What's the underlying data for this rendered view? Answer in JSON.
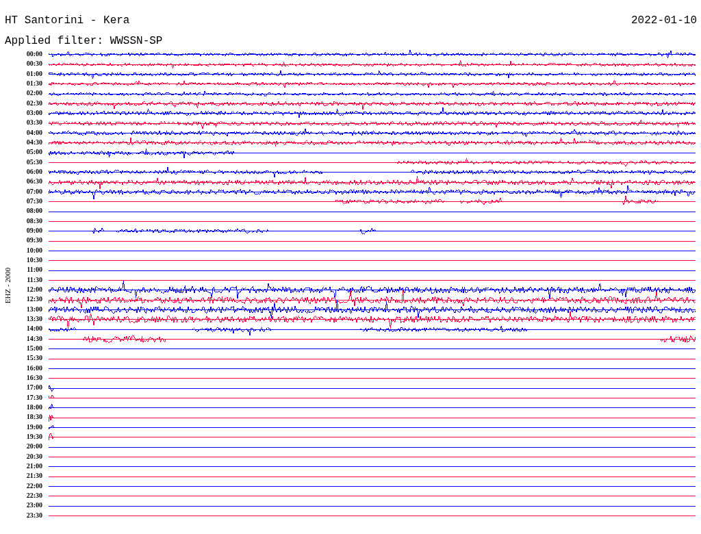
{
  "header": {
    "title": "HT Santorini - Kera",
    "filter": "Applied filter: WWSSN-SP",
    "date": "2022-01-10"
  },
  "channel_label": "EHZ - 2000",
  "traces": [
    {
      "time": "00:00",
      "color": "#0000ff"
    },
    {
      "time": "00:30",
      "color": "#ff0040"
    },
    {
      "time": "01:00",
      "color": "#0000ff"
    },
    {
      "time": "01:30",
      "color": "#ff0040"
    },
    {
      "time": "02:00",
      "color": "#0000ff"
    },
    {
      "time": "02:30",
      "color": "#ff0040"
    },
    {
      "time": "03:00",
      "color": "#0000ff"
    },
    {
      "time": "03:30",
      "color": "#ff0040"
    },
    {
      "time": "04:00",
      "color": "#0000ff"
    },
    {
      "time": "04:30",
      "color": "#ff0040"
    },
    {
      "time": "05:00",
      "color": "#0000ff"
    },
    {
      "time": "05:30",
      "color": "#ff0040"
    },
    {
      "time": "06:00",
      "color": "#0000ff"
    },
    {
      "time": "06:30",
      "color": "#ff0040"
    },
    {
      "time": "07:00",
      "color": "#0000ff"
    },
    {
      "time": "07:30",
      "color": "#ff0040"
    },
    {
      "time": "08:00",
      "color": "#0000ff"
    },
    {
      "time": "08:30",
      "color": "#ff0040"
    },
    {
      "time": "09:00",
      "color": "#0000ff"
    },
    {
      "time": "09:30",
      "color": "#ff0040"
    },
    {
      "time": "10:00",
      "color": "#0000ff"
    },
    {
      "time": "10:30",
      "color": "#ff0040"
    },
    {
      "time": "11:00",
      "color": "#0000ff"
    },
    {
      "time": "11:30",
      "color": "#ff0040"
    },
    {
      "time": "12:00",
      "color": "#0000ff"
    },
    {
      "time": "12:30",
      "color": "#ff0040"
    },
    {
      "time": "13:00",
      "color": "#0000ff"
    },
    {
      "time": "13:30",
      "color": "#ff0040"
    },
    {
      "time": "14:00",
      "color": "#0000ff"
    },
    {
      "time": "14:30",
      "color": "#ff0040"
    },
    {
      "time": "15:00",
      "color": "#0000ff"
    },
    {
      "time": "15:30",
      "color": "#ff0040"
    },
    {
      "time": "16:00",
      "color": "#0000ff"
    },
    {
      "time": "16:30",
      "color": "#ff0040"
    },
    {
      "time": "17:00",
      "color": "#0000ff"
    },
    {
      "time": "17:30",
      "color": "#ff0040"
    },
    {
      "time": "18:00",
      "color": "#0000ff"
    },
    {
      "time": "18:30",
      "color": "#ff0040"
    },
    {
      "time": "19:00",
      "color": "#0000ff"
    },
    {
      "time": "19:30",
      "color": "#ff0040"
    },
    {
      "time": "20:00",
      "color": "#0000ff"
    },
    {
      "time": "20:30",
      "color": "#ff0040"
    },
    {
      "time": "21:00",
      "color": "#0000ff"
    },
    {
      "time": "21:30",
      "color": "#ff0040"
    },
    {
      "time": "22:00",
      "color": "#0000ff"
    },
    {
      "time": "22:30",
      "color": "#ff0040"
    },
    {
      "time": "23:00",
      "color": "#0000ff"
    },
    {
      "time": "23:30",
      "color": "#ff0040"
    }
  ]
}
